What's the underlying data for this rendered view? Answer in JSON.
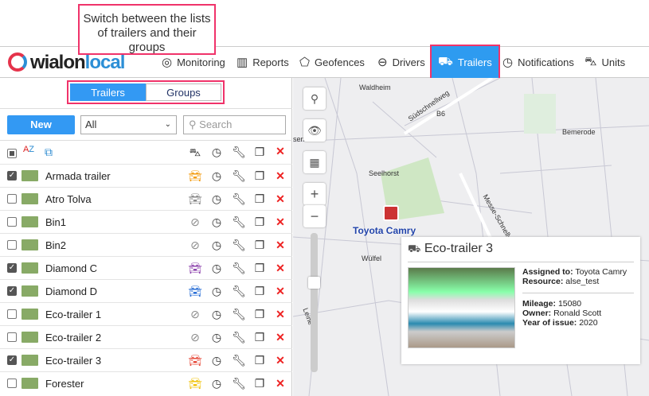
{
  "callout": "Switch between the lists of trailers and their groups",
  "logo": {
    "a": "wialon",
    "b": "local"
  },
  "nav": [
    {
      "label": "Monitoring",
      "icon": "monitoring-icon"
    },
    {
      "label": "Reports",
      "icon": "reports-icon"
    },
    {
      "label": "Geofences",
      "icon": "geofences-icon"
    },
    {
      "label": "Drivers",
      "icon": "drivers-icon"
    },
    {
      "label": "Trailers",
      "icon": "trailer-icon"
    },
    {
      "label": "Notifications",
      "icon": "notifications-icon"
    },
    {
      "label": "Units",
      "icon": "units-icon"
    }
  ],
  "tabs": {
    "trailers": "Trailers",
    "groups": "Groups"
  },
  "toolbar": {
    "new": "New",
    "filter": "All",
    "search_placeholder": "Search"
  },
  "rows": [
    {
      "name": "Armada trailer",
      "checked": true,
      "unit": "car-orange"
    },
    {
      "name": "Atro Tolva",
      "checked": false,
      "unit": "van-grey"
    },
    {
      "name": "Bin1",
      "checked": false,
      "unit": "unlinked"
    },
    {
      "name": "Bin2",
      "checked": false,
      "unit": "unlinked"
    },
    {
      "name": "Diamond C",
      "checked": true,
      "unit": "car-purple"
    },
    {
      "name": "Diamond D",
      "checked": true,
      "unit": "car-blue"
    },
    {
      "name": "Eco-trailer 1",
      "checked": false,
      "unit": "unlinked"
    },
    {
      "name": "Eco-trailer 2",
      "checked": false,
      "unit": "unlinked"
    },
    {
      "name": "Eco-trailer 3",
      "checked": true,
      "unit": "car-red"
    },
    {
      "name": "Forester",
      "checked": false,
      "unit": "car-yellow"
    }
  ],
  "map": {
    "labels": [
      "Waldheim",
      "Südschnellweg",
      "B6",
      "Bemerode",
      "Seelhorst",
      "Wülfel",
      "Messe-Schnellweg",
      "Leine",
      "sen"
    ],
    "unit_label": "Toyota Camry"
  },
  "popup": {
    "title": "Eco-trailer 3",
    "assigned_k": "Assigned to:",
    "assigned_v": "Toyota Camry",
    "resource_k": "Resource:",
    "resource_v": "alse_test",
    "mileage_k": "Mileage:",
    "mileage_v": "15080",
    "owner_k": "Owner:",
    "owner_v": "Ronald Scott",
    "year_k": "Year of issue:",
    "year_v": "2020"
  }
}
